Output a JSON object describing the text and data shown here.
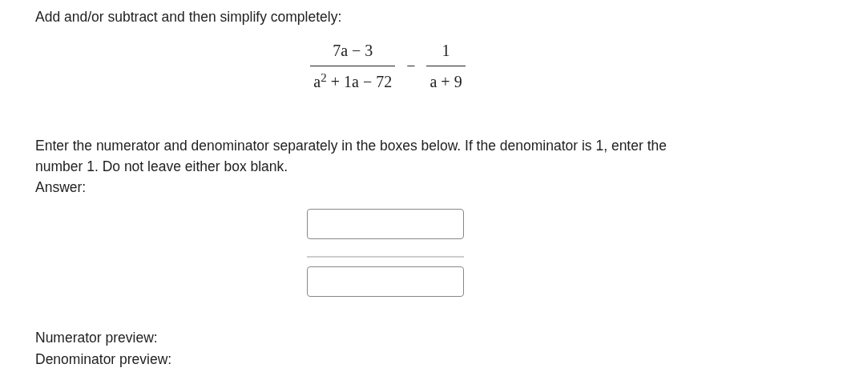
{
  "instruction": "Add and/or subtract and then simplify completely:",
  "expression": [
    {
      "kind": "fraction",
      "numerator": "7a − 3",
      "denominator": "a$^{2}$ + 1a − 72"
    },
    {
      "kind": "operator",
      "symbol": "−"
    },
    {
      "kind": "fraction",
      "numerator": "1",
      "denominator": "a + 9"
    }
  ],
  "directions": "Enter the numerator and denominator separately in the boxes below. If the denominator is 1, enter the number 1. Do not leave either box blank.",
  "answer_label": "Answer:",
  "previews": [
    {
      "label": "Numerator preview:"
    },
    {
      "label": "Denominator preview:"
    }
  ]
}
